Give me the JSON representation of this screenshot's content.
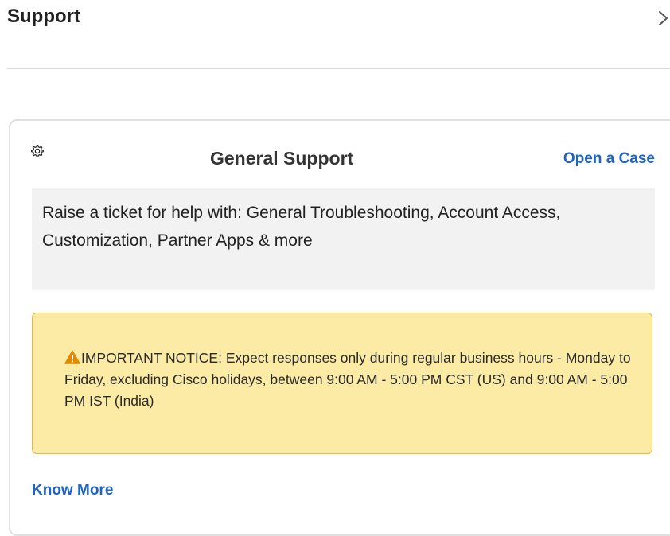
{
  "header": {
    "title": "Support",
    "chevron_icon": "chevron-right-icon"
  },
  "card": {
    "gear_icon": "gear-icon",
    "title": "General Support",
    "action_label": "Open a Case",
    "description": "Raise a ticket for help with: General Troubleshooting, Account Access, Customization, Partner Apps & more",
    "notice": {
      "icon": "warning-icon",
      "text": "IMPORTANT NOTICE: Expect responses only during regular business hours - Monday to Friday, excluding Cisco holidays, between 9:00 AM - 5:00 PM CST (US) and 9:00 AM - 5:00 PM IST (India)"
    },
    "link_label": "Know More"
  },
  "colors": {
    "link": "#1f64c2",
    "notice_background": "#fbeba5",
    "notice_border": "#e2b84a",
    "warning_icon": "#e08a00",
    "description_background": "#f2f2f2"
  }
}
